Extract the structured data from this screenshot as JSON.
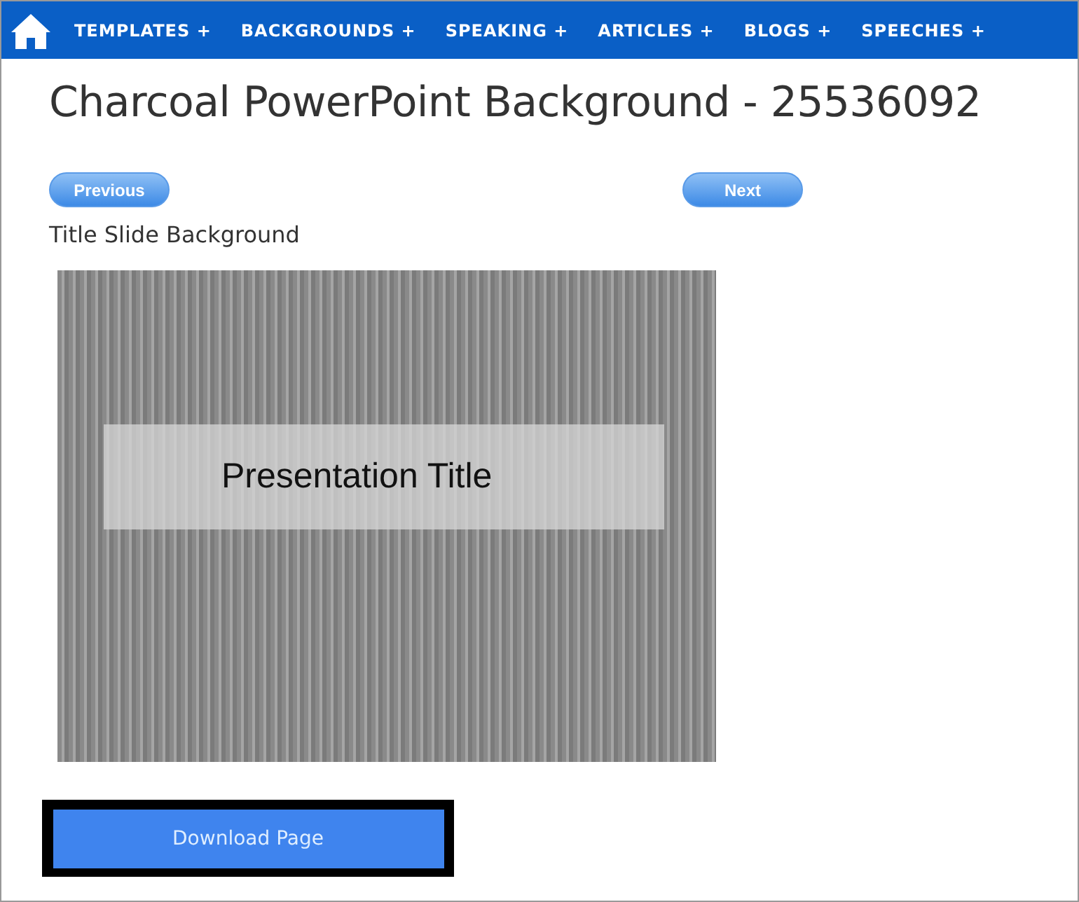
{
  "nav": {
    "items": [
      {
        "label": "TEMPLATES",
        "expander": "+"
      },
      {
        "label": "BACKGROUNDS",
        "expander": "+"
      },
      {
        "label": "SPEAKING",
        "expander": "+"
      },
      {
        "label": "ARTICLES",
        "expander": "+"
      },
      {
        "label": "BLOGS",
        "expander": "+"
      },
      {
        "label": "SPEECHES",
        "expander": "+"
      }
    ]
  },
  "title": "Charcoal PowerPoint Background - 25536092",
  "pager": {
    "previous": "Previous",
    "next": "Next"
  },
  "subtitle": "Title Slide Background",
  "slide": {
    "title": "Presentation Title"
  },
  "download": "Download Page"
}
